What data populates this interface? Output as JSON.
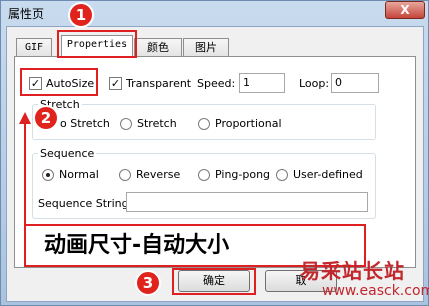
{
  "window": {
    "title": "属性页",
    "close_label": "X"
  },
  "tabs": [
    "GIF",
    "Properties",
    "颜色",
    "图片"
  ],
  "properties": {
    "autosize": {
      "label": "AutoSize",
      "checked": true
    },
    "transparent": {
      "label": "Transparent",
      "checked": true
    },
    "speed_label": "Speed:",
    "speed_value": "1",
    "loop_label": "Loop:",
    "loop_value": "0"
  },
  "stretch": {
    "legend": "Stretch",
    "options": [
      "o Stretch",
      "Stretch",
      "Proportional"
    ]
  },
  "sequence": {
    "legend": "Sequence",
    "options": [
      "Normal",
      "Reverse",
      "Ping-pong",
      "User-defined"
    ],
    "selected": "Normal",
    "string_label": "Sequence String:",
    "string_value": ""
  },
  "buttons": {
    "ok": "确定",
    "cancel_partial": "取"
  },
  "annotations": {
    "badges": [
      "1",
      "2",
      "3"
    ],
    "caption": "动画尺寸-自动大小",
    "accent_color": "#e02020"
  },
  "watermark": {
    "line1": "易采站长站",
    "line2": "www.easck.com"
  }
}
